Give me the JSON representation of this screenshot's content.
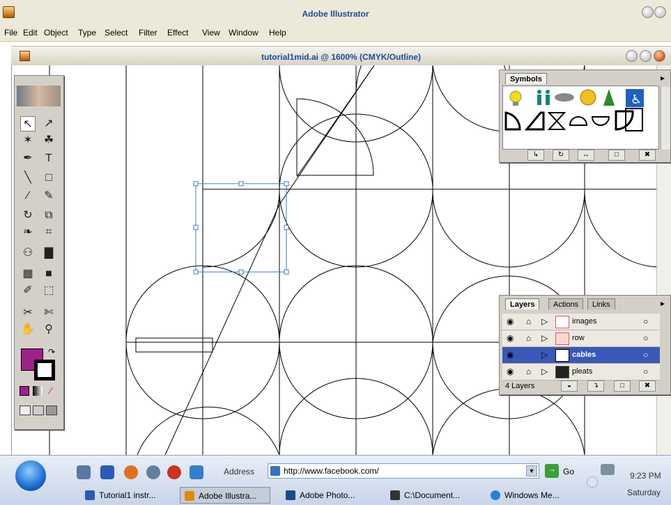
{
  "app": {
    "title": "Adobe Illustrator"
  },
  "menu": [
    "File",
    "Edit",
    "Object",
    "Type",
    "Select",
    "Filter",
    "Effect",
    "View",
    "Window",
    "Help"
  ],
  "document": {
    "title": "tutorial1mid.ai @ 1600% (CMYK/Outline)"
  },
  "colors": {
    "fill": "#a0208a",
    "stroke": "#000000",
    "selection": "#3a78c8",
    "selected_layer": "#3a58b8"
  },
  "symbols_palette": {
    "tab": "Symbols",
    "symbols": [
      "lightbulb-icon",
      "restroom-icon",
      "fish-icon",
      "lantern-icon",
      "tree-icon",
      "wheelchair-icon",
      "half-circle-icon",
      "wedge-icon",
      "hourglass-icon",
      "dome-icon",
      "bowl-icon",
      "quarter-round-icon"
    ],
    "buttons": [
      "place-symbol-icon",
      "replace-symbol-icon",
      "break-link-icon",
      "new-symbol-icon",
      "delete-icon"
    ]
  },
  "layers_palette": {
    "tabs": [
      "Layers",
      "Actions",
      "Links"
    ],
    "layers": [
      {
        "name": "images",
        "selected": false,
        "lock": true
      },
      {
        "name": "row",
        "selected": false,
        "lock": true
      },
      {
        "name": "cables",
        "selected": true,
        "lock": false
      },
      {
        "name": "pleats",
        "selected": false,
        "lock": true
      }
    ],
    "count": "4 Layers"
  },
  "taskbar": {
    "address_label": "Address",
    "address": "http://www.facebook.com/",
    "go_label": "Go",
    "clock": "9:23 PM",
    "day": "Saturday",
    "tasks": [
      {
        "label": "Tutorial1 instr...",
        "active": false,
        "color": "#2a5ab8"
      },
      {
        "label": "Adobe Illustra...",
        "active": true,
        "color": "#e08a00"
      },
      {
        "label": "Adobe Photo...",
        "active": false,
        "color": "#1a4a8a"
      },
      {
        "label": "C:\\Document...",
        "active": false,
        "color": "#333"
      },
      {
        "label": "Windows Me...",
        "active": false,
        "color": "#2a80d0"
      }
    ]
  }
}
